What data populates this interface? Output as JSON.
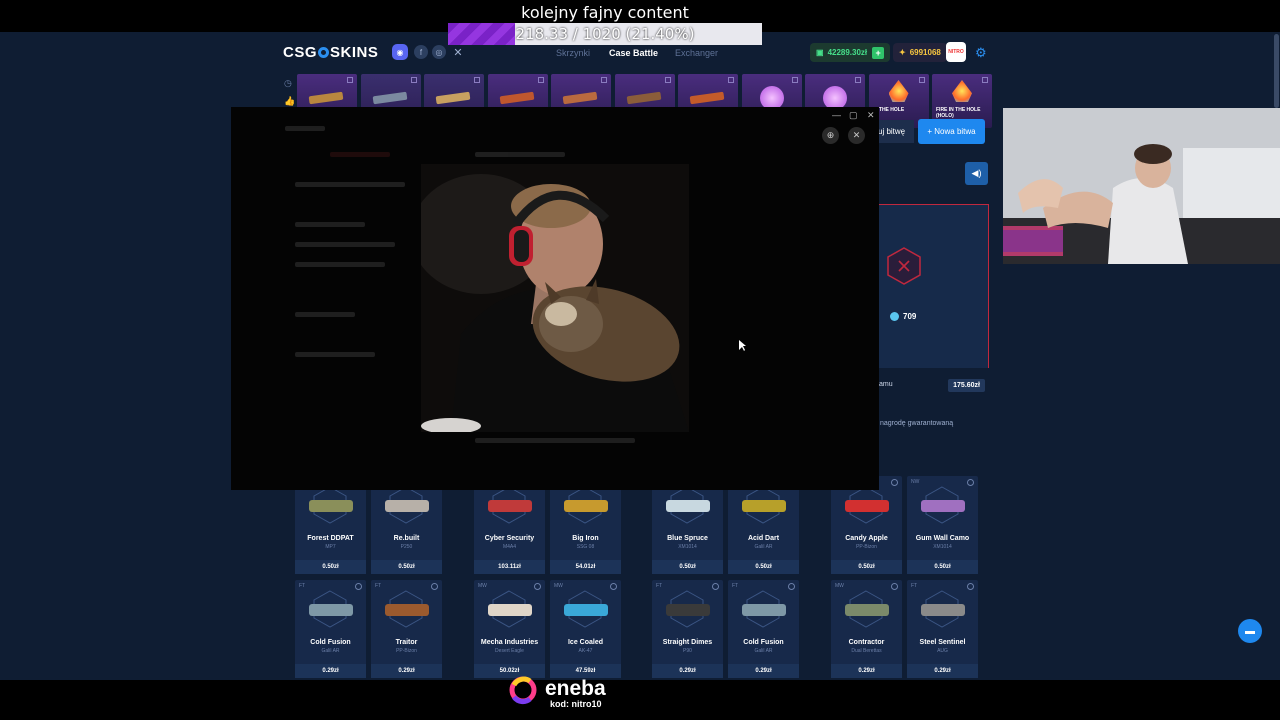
{
  "stream": {
    "goal_title": "kolejny fajny content",
    "goal_text": "218.33 / 1020 (21.40%)",
    "goal_progress": 0.214
  },
  "site": {
    "logo_left": "CSG",
    "logo_right": "SKINS",
    "nav_tabs": [
      "Skrzynki",
      "Case Battle",
      "Exchanger"
    ],
    "active_tab": "Case Battle",
    "balance_main": "42289.30zł",
    "balance_coins": "6991068",
    "nitro_badge": "NITRO"
  },
  "drops": [
    {
      "color": "#4a2d7e",
      "gun": "#b9873f",
      "label": ""
    },
    {
      "color": "#3a2f6e",
      "gun": "#7b8aa0",
      "label": ""
    },
    {
      "color": "#3a2f6e",
      "gun": "#c7a060",
      "label": ""
    },
    {
      "color": "#4a2d7e",
      "gun": "#c0572e",
      "label": ""
    },
    {
      "color": "#4a2d7e",
      "gun": "#b96a3f",
      "label": ""
    },
    {
      "color": "#4a2d7e",
      "gun": "#8b5d3a",
      "label": ""
    },
    {
      "color": "#4a2d7e",
      "gun": "#c45b2a",
      "label": ""
    },
    {
      "color": "#4a2d7e",
      "gun": "",
      "label": ""
    },
    {
      "color": "#4a2d7e",
      "gun": "",
      "label": ""
    },
    {
      "color": "#4a2d7e",
      "gun": "",
      "label": "IN THE HOLE"
    },
    {
      "color": "#4a2d7e",
      "gun": "",
      "label": "FIRE IN THE HOLE (HOLO)"
    }
  ],
  "battle": {
    "join_label": "uj bitwę",
    "new_label": "+ Nowa bitwa",
    "coins": "709",
    "row_label": "amu",
    "row_price": "175.60zł",
    "guarantee_text": "nagrodę gwarantowaną"
  },
  "items_row1": [
    {
      "name": "Forest DDPAT",
      "sub": "MP7",
      "price": "0.50zł",
      "wear": "",
      "gun": "#8a8f5a"
    },
    {
      "name": "Re.built",
      "sub": "P250",
      "price": "0.50zł",
      "wear": "",
      "gun": "#b7b0a8"
    },
    {
      "name": "Cyber Security",
      "sub": "M4A4",
      "price": "103.11zł",
      "wear": "",
      "gun": "#c03a3a"
    },
    {
      "name": "Big Iron",
      "sub": "SSG 08",
      "price": "54.01zł",
      "wear": "",
      "gun": "#c79a2e"
    },
    {
      "name": "Blue Spruce",
      "sub": "XM1014",
      "price": "0.50zł",
      "wear": "",
      "gun": "#c8d8e0"
    },
    {
      "name": "Acid Dart",
      "sub": "Galil AR",
      "price": "0.50zł",
      "wear": "",
      "gun": "#b7a02a"
    },
    {
      "name": "Candy Apple",
      "sub": "PP-Bizon",
      "price": "0.50zł",
      "wear": "",
      "gun": "#d23030"
    },
    {
      "name": "Gum Wall Camo",
      "sub": "XM1014",
      "price": "0.50zł",
      "wear": "NW",
      "gun": "#a070c0"
    }
  ],
  "items_row2": [
    {
      "name": "Cold Fusion",
      "sub": "Galil AR",
      "price": "0.29zł",
      "wear": "FT",
      "gun": "#7e98a6"
    },
    {
      "name": "Traitor",
      "sub": "PP-Bizon",
      "price": "0.29zł",
      "wear": "FT",
      "gun": "#9b5a2e"
    },
    {
      "name": "Mecha Industries",
      "sub": "Desert Eagle",
      "price": "50.02zł",
      "wear": "MW",
      "gun": "#e0d6c8"
    },
    {
      "name": "Ice Coaled",
      "sub": "AK-47",
      "price": "47.59zł",
      "wear": "MW",
      "gun": "#3aa8d8"
    },
    {
      "name": "Straight Dimes",
      "sub": "P90",
      "price": "0.29zł",
      "wear": "FT",
      "gun": "#3a3a3a"
    },
    {
      "name": "Cold Fusion",
      "sub": "Galil AR",
      "price": "0.29zł",
      "wear": "FT",
      "gun": "#7e98a6"
    },
    {
      "name": "Contractor",
      "sub": "Dual Berettas",
      "price": "0.29zł",
      "wear": "MW",
      "gun": "#7b8a6a"
    },
    {
      "name": "Steel Sentinel",
      "sub": "AUG",
      "price": "0.29zł",
      "wear": "FT",
      "gun": "#8a8a8a"
    }
  ],
  "sponsor": {
    "name": "eneba",
    "code": "kod: nitro10"
  },
  "colors": {
    "site_bg": "#0f1d33",
    "accent": "#1e88ef",
    "goal_purple": "#7a22c7"
  }
}
